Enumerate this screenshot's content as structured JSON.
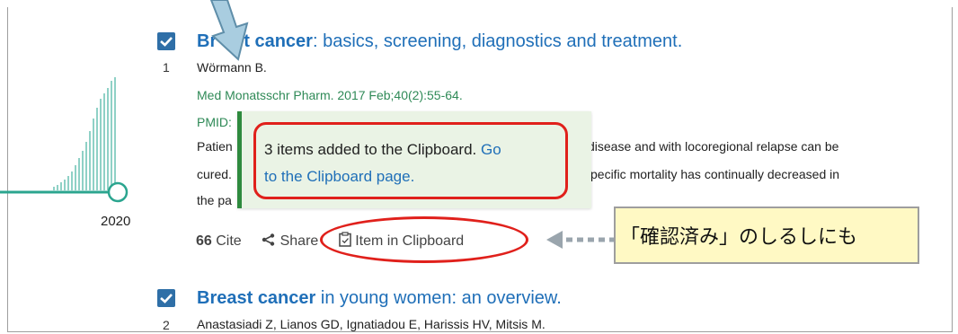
{
  "results": [
    {
      "number": "1",
      "title_bold": "Br",
      "title_bold_tail": "t cancer",
      "title_rest": ": basics, screening, diagnostics and treatment.",
      "authors": "Wörmann B.",
      "citation": "Med Monatsschr Pharm. 2017 Feb;40(2):55-64.",
      "pmid": "PMID:",
      "snippet_1a": "Patien",
      "snippet_1b": "disease and with locoregional relapse can be",
      "snippet_2a": "cured.",
      "snippet_2b": "specific mortality has continually decreased in",
      "snippet_3a": "the pa"
    },
    {
      "number": "2",
      "title_bold": "Breast cancer",
      "title_rest": " in young women: an overview.",
      "authors": "Anastasiadi Z, Lianos GD, Ignatiadou E, Harissis HV, Mitsis M."
    }
  ],
  "timeline": {
    "year": "2020"
  },
  "actions": {
    "cite_icon": "66",
    "cite_label": "Cite",
    "share_label": "Share",
    "clipboard_label": "Item in Clipboard"
  },
  "tooltip": {
    "message": "3 items added to the Clipboard. ",
    "link_text_1": "Go",
    "link_text_2": "to the Clipboard page."
  },
  "callout": {
    "text": "「確認済み」のしるしにも"
  },
  "colors": {
    "link": "#1f6fb8",
    "citation": "#2f8a57",
    "checkbox": "#2f6fa7",
    "annotation_red": "#e0201b",
    "tooltip_bg": "#eaf3e5",
    "callout_bg": "#fff9c4"
  }
}
